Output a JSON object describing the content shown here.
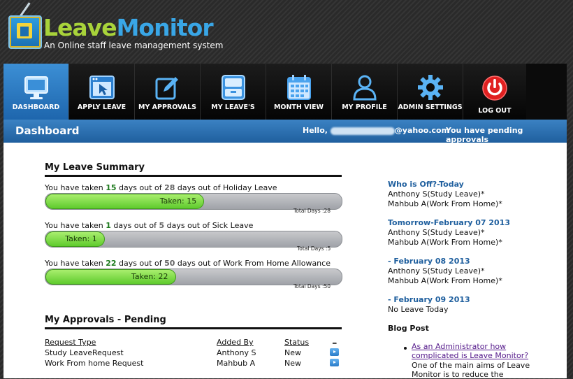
{
  "brand": {
    "name_part1": "Leave",
    "name_part2": "Monitor",
    "tagline": "An Online staff leave management system"
  },
  "nav": {
    "items": [
      {
        "label": "DASHBOARD",
        "icon": "monitor-icon",
        "active": true
      },
      {
        "label": "APPLY LEAVE",
        "icon": "browser-cursor-icon"
      },
      {
        "label": "MY APPROVALS",
        "icon": "edit-icon"
      },
      {
        "label": "MY LEAVE'S",
        "icon": "inbox-icon"
      },
      {
        "label": "MONTH VIEW",
        "icon": "calendar-icon"
      },
      {
        "label": "MY PROFILE",
        "icon": "user-icon"
      },
      {
        "label": "ADMIN SETTINGS",
        "icon": "gear-icon"
      },
      {
        "label": "LOG OUT",
        "icon": "power-icon"
      }
    ]
  },
  "titlebar": {
    "title": "Dashboard",
    "hello_prefix": "Hello,",
    "hello_email_suffix": "@yahoo.com",
    "pending_notice": "You have pending approvals"
  },
  "leave_summary": {
    "title": "My Leave Summary",
    "prefix": "You have taken",
    "mid": "days out of",
    "suffix": "days out of",
    "taken_prefix": "Taken:",
    "total_prefix": "Total Days :",
    "items": [
      {
        "taken": "15",
        "total": "28",
        "type": "Holiday Leave",
        "fraction": 0.536
      },
      {
        "taken": "1",
        "total": "5",
        "type": "Sick Leave",
        "fraction": 0.2
      },
      {
        "taken": "22",
        "total": "50",
        "type": "Work From Home Allowance",
        "fraction": 0.44
      }
    ]
  },
  "approvals": {
    "title": "My Approvals - Pending",
    "headers": [
      "Request Type",
      "Added By",
      "Status",
      "_"
    ],
    "rows": [
      {
        "type": "Study LeaveRequest",
        "added_by": "Anthony S",
        "status": "New"
      },
      {
        "type": "Work From home Request",
        "added_by": "Mahbub A",
        "status": "New"
      }
    ]
  },
  "whos_off": {
    "sections": [
      {
        "heading": "Who is Off?-Today",
        "lines": [
          "Anthony S(Study Leave)*",
          "Mahbub A(Work From Home)*"
        ]
      },
      {
        "heading": "Tomorrow-February 07 2013",
        "lines": [
          "Anthony S(Study Leave)*",
          "Mahbub A(Work From Home)*"
        ]
      },
      {
        "heading": "- February 08 2013",
        "lines": [
          "Anthony S(Study Leave)*",
          "Mahbub A(Work From Home)*"
        ]
      },
      {
        "heading": "- February 09 2013",
        "lines": [
          "No Leave Today"
        ]
      }
    ]
  },
  "blog": {
    "title": "Blog Post",
    "link": "As an Administrator how complicated is Leave Monitor?",
    "excerpt": "One of the main aims of Leave Monitor is to reduce the"
  },
  "colors": {
    "accent_blue": "#1f5f9e",
    "bar_green": "#5fcb2d",
    "logo_green": "#a8d33a",
    "logo_blue": "#39a6e6"
  }
}
